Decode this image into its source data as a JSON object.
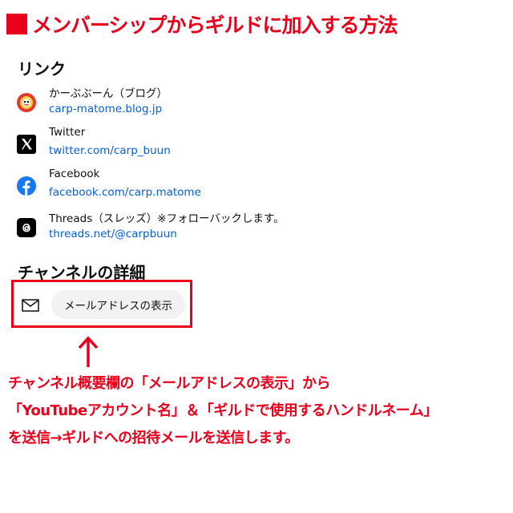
{
  "title": "メンバーシップからギルドに加入する方法",
  "links_heading": "リンク",
  "links": [
    {
      "name": "かーぷぶーん（ブログ）",
      "url": "carp-matome.blog.jp",
      "icon": "blog-logo-icon"
    },
    {
      "name": "Twitter",
      "url": "twitter.com/carp_buun",
      "icon": "x-logo-icon"
    },
    {
      "name": "Facebook",
      "url": "facebook.com/carp.matome",
      "icon": "facebook-logo-icon"
    },
    {
      "name": "Threads（スレッズ）※フォローバックします。",
      "url": "threads.net/@carpbuun",
      "icon": "threads-logo-icon"
    }
  ],
  "channel_details_heading": "チャンネルの詳細",
  "email_button_label": "メールアドレスの表示",
  "note_lines": [
    "チャンネル概要欄の「メールアドレスの表示」から",
    "「YouTubeアカウント名」＆「ギルドで使用するハンドルネーム」",
    "を送信→ギルドへの招待メールを送信します。"
  ],
  "colors": {
    "accent_red": "#e8001c",
    "link_blue": "#065fd4",
    "facebook_blue": "#1877f2"
  }
}
